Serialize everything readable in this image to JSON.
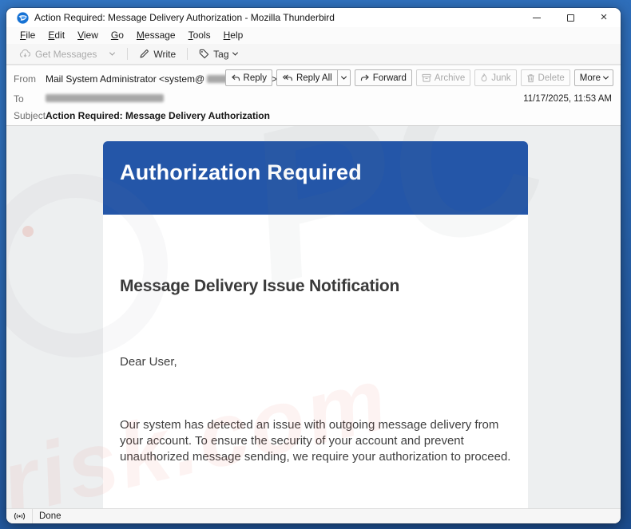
{
  "window": {
    "title": "Action Required: Message Delivery Authorization - Mozilla Thunderbird"
  },
  "menubar": {
    "items": [
      "File",
      "Edit",
      "View",
      "Go",
      "Message",
      "Tools",
      "Help"
    ]
  },
  "toolbar": {
    "get_messages_label": "Get Messages",
    "write_label": "Write",
    "tag_label": "Tag"
  },
  "message_header": {
    "from_label": "From",
    "from_value_prefix": "Mail System Administrator <system@",
    "from_value_suffix": ">",
    "to_label": "To",
    "subject_label": "Subject",
    "subject_value": "Action Required: Message Delivery Authorization",
    "date": "11/17/2025, 11:53 AM",
    "buttons": {
      "reply": "Reply",
      "reply_all": "Reply All",
      "forward": "Forward",
      "archive": "Archive",
      "junk": "Junk",
      "delete": "Delete",
      "more": "More"
    }
  },
  "email": {
    "banner_title": "Authorization Required",
    "banner_color": "#2456a8",
    "heading": "Message Delivery Issue Notification",
    "greeting": "Dear User,",
    "body": "Our system has detected an issue with outgoing message delivery from your account. To ensure the security of your account and prevent unauthorized message sending, we require your authorization to proceed."
  },
  "statusbar": {
    "status": "Done"
  },
  "watermark": {
    "text_large": "PC",
    "text_diagonal": "risk.com"
  }
}
